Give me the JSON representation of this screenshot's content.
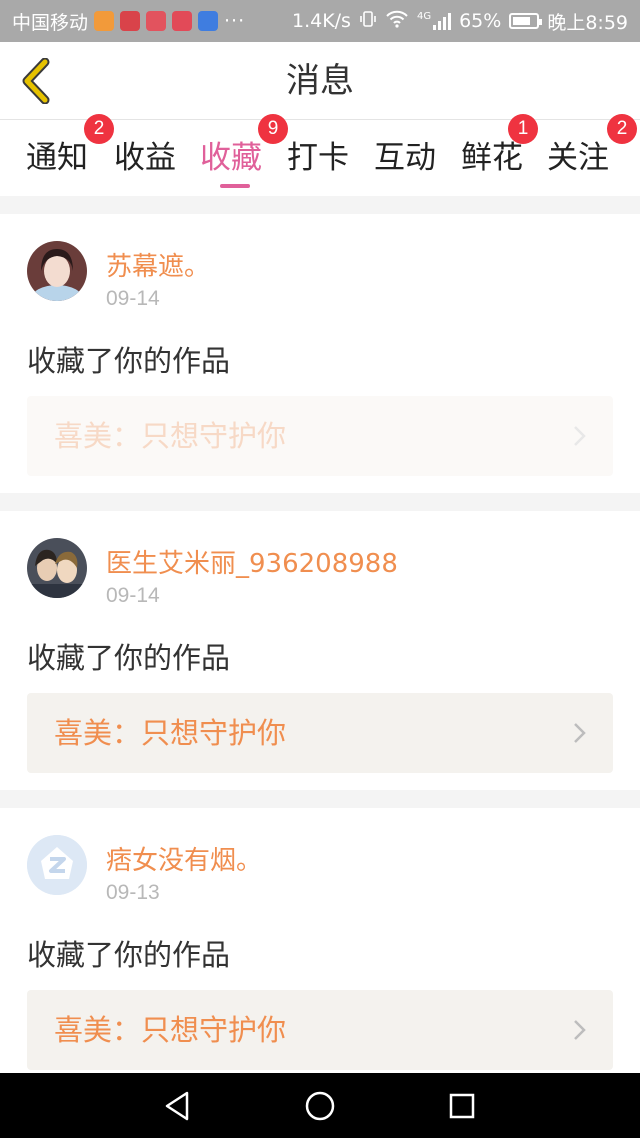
{
  "status_bar": {
    "carrier": "中国移动",
    "more": "···",
    "speed": "1.4K/s",
    "network": "4G",
    "battery": "65%",
    "time": "晚上8:59"
  },
  "header": {
    "title": "消息"
  },
  "tabs": [
    {
      "label": "通知",
      "badge": "2"
    },
    {
      "label": "收益",
      "badge": ""
    },
    {
      "label": "收藏",
      "badge": "9"
    },
    {
      "label": "打卡",
      "badge": ""
    },
    {
      "label": "互动",
      "badge": ""
    },
    {
      "label": "鲜花",
      "badge": "1"
    },
    {
      "label": "关注",
      "badge": "2"
    }
  ],
  "active_tab": "收藏",
  "messages": [
    {
      "user": "苏幕遮。",
      "date": "09-14",
      "action": "收藏了你的作品",
      "work": "喜美：只想守护你"
    },
    {
      "user": "医生艾米丽_936208988",
      "date": "09-14",
      "action": "收藏了你的作品",
      "work": "喜美：只想守护你"
    },
    {
      "user": "痞女没有烟。",
      "date": "09-13",
      "action": "收藏了你的作品",
      "work": "喜美：只想守护你"
    }
  ],
  "colors": {
    "accent": "#e0609a",
    "username": "#f08e4f",
    "badge": "#ef3340",
    "back_arrow": "#e6c200"
  }
}
